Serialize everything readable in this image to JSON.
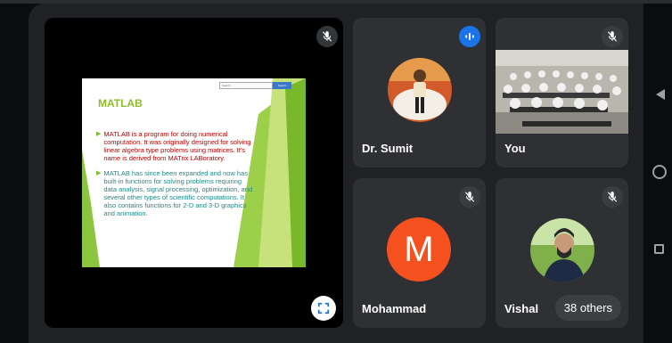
{
  "presentation": {
    "slide": {
      "title": "MATLAB",
      "search_placeholder": "Search",
      "search_button": "Search",
      "bullets": [
        {
          "text": "MATLAB is a program for doing numerical computation. It was originally designed for solving linear algebra type problems using matrices. It's name is derived from MATrix LABoratory."
        },
        {
          "text": "MATLAB has since been expanded and now has built-in functions for solving problems requiring data analysis, signal processing, optimization, and several other types of scientific computations. It also contains functions for 2-D and 3-D graphics and animation."
        }
      ]
    }
  },
  "participants": {
    "sumit": {
      "name": "Dr. Sumit"
    },
    "you": {
      "name": "You"
    },
    "mohammad": {
      "name": "Mohammad",
      "initial": "M"
    },
    "vishal": {
      "name": "Vishal",
      "others_badge": "38 others"
    }
  },
  "colors": {
    "avatar_orange": "#f4511e",
    "speaking_blue": "#1a73e8",
    "tile_bg": "#2f3034"
  },
  "icons": {
    "muted": "mic-off-icon",
    "speaking": "audio-wave-icon",
    "fullscreen": "fullscreen-icon"
  }
}
